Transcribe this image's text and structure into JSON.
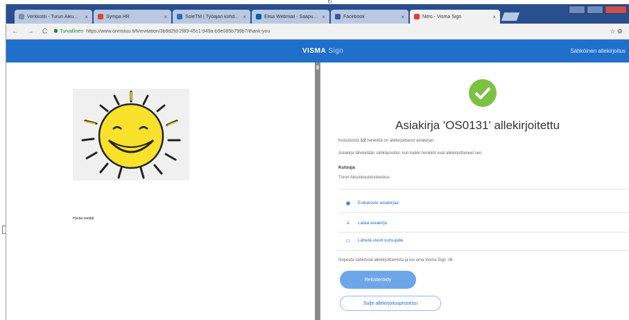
{
  "browser": {
    "tabs": [
      {
        "label": "Verkkotili - Turun Aiku...",
        "icon": "generic-tab-icon",
        "color": "#7a8fb0"
      },
      {
        "label": "Sympa HR",
        "icon": "sympa-icon",
        "color": "#d9482b"
      },
      {
        "label": "SoleTM | Työajan kohd...",
        "icon": "soletm-icon",
        "color": "#2b6cc4"
      },
      {
        "label": "Elisa Webmail - Saapun...",
        "icon": "elisa-icon",
        "color": "#0063b1"
      },
      {
        "label": "Facebook",
        "icon": "facebook-icon",
        "color": "#3b5998"
      },
      {
        "label": "Nitro - Visma Sign",
        "icon": "nitro-icon",
        "color": "#e53935"
      }
    ],
    "tab_close": "×",
    "nav": {
      "back": "←",
      "forward": "→",
      "reload": "C"
    },
    "secure_label": "Turvallinen",
    "url": "https://www.onnistuu.fi/fi/invitation/3b9d2fd-2f89-45c1-949a-b9e085b799b7/thank-you",
    "addr_icons": "☆ ⚙"
  },
  "header": {
    "logo_bold": "VISMA",
    "logo_light": " Sign",
    "right_link": "Sähköinen allekirjoitus"
  },
  "document": {
    "image": "smiling-sun-image",
    "text": "Hyvää meidät"
  },
  "panel": {
    "title": "Asiakirja 'OS0131' allekirjoitettu",
    "signed_count_prefix": "Kutsutuista ",
    "signed_count": "1/2",
    "signed_count_suffix": " henkilöä on allekirjoittanut asiakirjan.",
    "delivery_note": "Asiakirja lähetetään sähköpostiisi, kun kaikki henkilöt ovat allekirjoittaneet sen.",
    "inviter_label": "Kutsuja",
    "inviter_value": "Turun Aikuiskoulutuskeskus",
    "actions": [
      {
        "label": "Esikatsele asiakirjaa",
        "icon": "eye-icon",
        "glyph": "◉"
      },
      {
        "label": "Lataa asiakirja",
        "icon": "download-icon",
        "glyph": "⤓"
      },
      {
        "label": "Lähetä viesti kutsujalle",
        "icon": "message-icon",
        "glyph": "▭"
      }
    ],
    "promo": "Nopeuta sähköistä allekirjoittamista ja luo oma Visma Sign -tili.",
    "register_button": "Rekisteröidy",
    "close_button": "Sulje allekirjoitusprosessi"
  },
  "colors": {
    "brand_blue": "#1f6fcb",
    "success_green": "#7cc142"
  }
}
